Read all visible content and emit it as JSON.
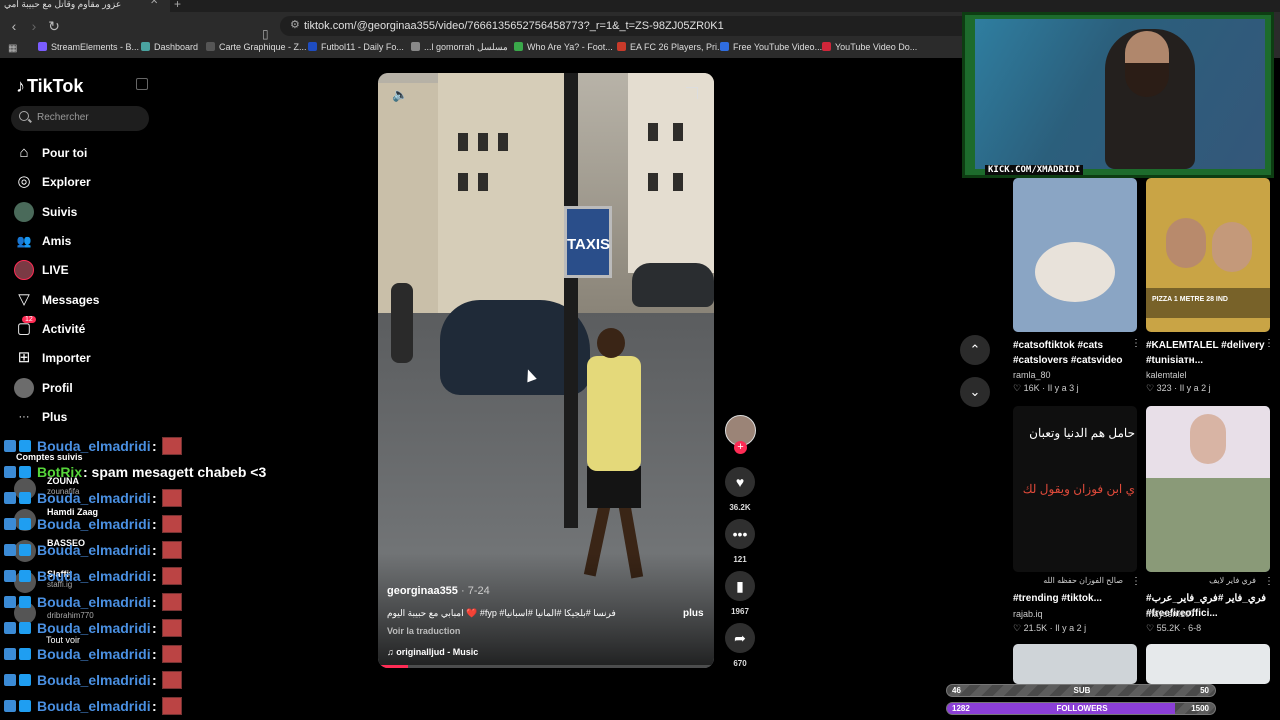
{
  "browser": {
    "tab_title": "عزور مقاوم وقاتل مع حبيبة امي",
    "tab_close": "✕",
    "tab_new": "+",
    "url": "tiktok.com/@georginaa355/video/7666135652756458773?_r=1&_t=ZS-98ZJ05ZR0K1",
    "bookmarks": [
      {
        "label": "StreamElements - B...",
        "color": "#7b5cff"
      },
      {
        "label": "Dashboard",
        "color": "#4aa3a0"
      },
      {
        "label": "Carte Graphique - Z...",
        "color": "#555"
      },
      {
        "label": "Futbol11 - Daily Fo...",
        "color": "#1e4cc0"
      },
      {
        "label": "...l gomorrah مسلسل",
        "color": "#888"
      },
      {
        "label": "Who Are Ya? - Foot...",
        "color": "#3aa84a"
      },
      {
        "label": "EA FC 26 Players, Pri...",
        "color": "#c83a2a"
      },
      {
        "label": "Free YouTube Video...",
        "color": "#2f6de0"
      },
      {
        "label": "YouTube Video Do...",
        "color": "#d0263a"
      }
    ]
  },
  "sidebar": {
    "logo": "TikTok",
    "search_placeholder": "Rechercher",
    "items": [
      {
        "label": "Pour toi",
        "icon": "⌂"
      },
      {
        "label": "Explorer",
        "icon": "◎"
      },
      {
        "label": "Suivis",
        "icon": ""
      },
      {
        "label": "Amis",
        "icon": "👥"
      },
      {
        "label": "LIVE",
        "icon": ""
      },
      {
        "label": "Messages",
        "icon": "▽"
      },
      {
        "label": "Activité",
        "icon": "▢",
        "badge": "12"
      },
      {
        "label": "Importer",
        "icon": "⊞"
      },
      {
        "label": "Profil",
        "icon": ""
      },
      {
        "label": "Plus",
        "icon": "···"
      }
    ],
    "follows_title": "Comptes suivis",
    "follows": [
      {
        "name": "ZOUNA",
        "handle": "zounafifa"
      },
      {
        "name": "Hamdi Zaag",
        "handle": ""
      },
      {
        "name": "BASSEO",
        "handle": ""
      },
      {
        "name": "Slaffit",
        "handle": "staffi.ig"
      },
      {
        "name": "",
        "handle": "dribrahim770"
      }
    ],
    "see_all": "Tout voir"
  },
  "chat": [
    {
      "user": "Bouda_elmadridi",
      "msg": ":"
    },
    {
      "user": "BotRix",
      "msg": ": spam mesagett chabeb <3",
      "bot": true
    },
    {
      "user": "Bouda_elmadridi",
      "msg": ":"
    },
    {
      "user": "Bouda_elmadridi",
      "msg": ":"
    },
    {
      "user": "Bouda_elmadridi",
      "msg": ":"
    },
    {
      "user": "Bouda_elmadridi",
      "msg": ":"
    },
    {
      "user": "Bouda_elmadridi",
      "msg": ":"
    },
    {
      "user": "Bouda_elmadridi",
      "msg": ":"
    },
    {
      "user": "Bouda_elmadridi",
      "msg": ":"
    },
    {
      "user": "Bouda_elmadridi",
      "msg": ":"
    },
    {
      "user": "Bouda_elmadridi",
      "msg": ":"
    }
  ],
  "video": {
    "author": "georginaa355",
    "date": "· 7-24",
    "description": "امبابي مع حبيبة اليوم ❤️ #fyp #فرنسا #بلجيكا #المانيا #اسبانيا",
    "more": "plus",
    "translate": "Voir la traduction",
    "music": "♫  originalljud - Music",
    "sign": "TAXIS",
    "progress": 0.09
  },
  "actions": {
    "likes": "36.2K",
    "comments": "121",
    "saves": "1967",
    "shares": "670"
  },
  "grid": [
    {
      "title": "#catsoftiktok #cats #catslovers #catsvideo",
      "author": "ramla_80",
      "meta": "♡ 16K  ·  Il y a 3 j",
      "bg": "#8aa5c4",
      "overlay": ""
    },
    {
      "title": "#KALEMTALEL #delivery #tunisiaтн...",
      "author": "kalemtalel",
      "meta": "♡ 323  ·  Il y a 2 j",
      "bg": "#c9a445",
      "overlay": "PIZZA 1 METRE 28 IND"
    },
    {
      "title": "#trending #tiktok...",
      "author": "rajab.iq",
      "meta": "♡ 21.5K  ·  Il y a 2 j",
      "bg": "#0f0f0f",
      "overlay": "حامل هم الدنيا وتعبان",
      "overlay2": "ي ابن فوزان ويقول لك",
      "caption": "صالح الفوزان حفظه الله"
    },
    {
      "title": "#فري_فاير #فري_فاير_عرب #freefireoffici...",
      "author": "maysem107",
      "meta": "♡ 55.2K  ·  6-8",
      "bg": "#5b7a8f",
      "overlay": "",
      "caption": "فري فاير لايف"
    }
  ],
  "webcam": {
    "label": "KICK.COM/XMADRIDI"
  },
  "goals": {
    "sub": {
      "left": "46",
      "center": "SUB",
      "right": "50",
      "fill": 0.0,
      "color": "#888"
    },
    "followers": {
      "left": "1282",
      "center": "FOLLOWERS",
      "right": "1500",
      "fill": 0.85,
      "color": "#8b3fd6"
    }
  }
}
